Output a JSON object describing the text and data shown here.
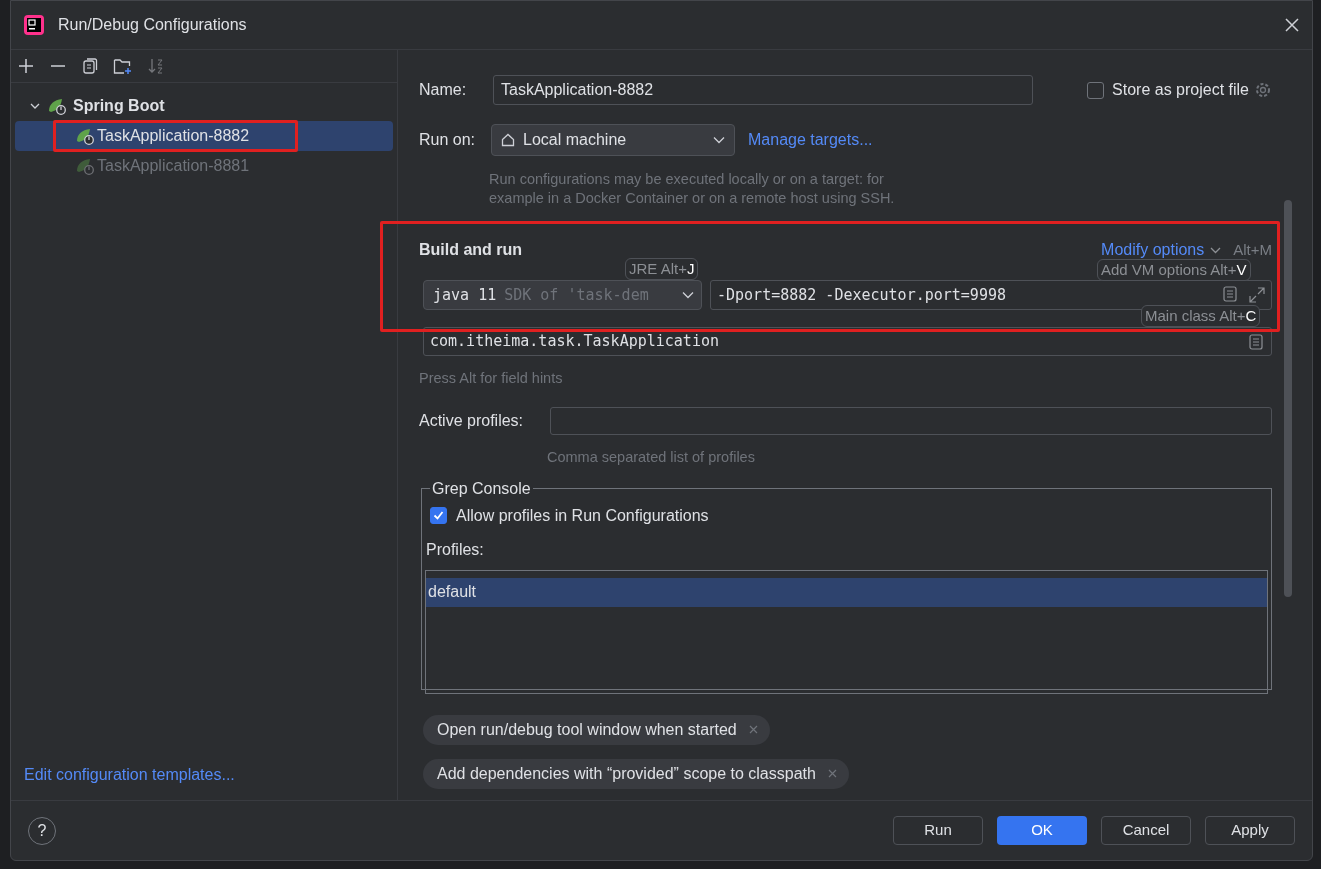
{
  "window": {
    "title": "Run/Debug Configurations"
  },
  "tree": [
    {
      "label": "Spring Boot",
      "expanded": true,
      "children": [
        {
          "label": "TaskApplication-8882",
          "selected": true,
          "dimmed": false
        },
        {
          "label": "TaskApplication-8881",
          "selected": false,
          "dimmed": true
        }
      ]
    }
  ],
  "templates_link": "Edit configuration templates...",
  "name": {
    "label": "Name:",
    "value": "TaskApplication-8882"
  },
  "store_as_project_file": {
    "label": "Store as project file",
    "checked": false
  },
  "run_on": {
    "label": "Run on:",
    "value": "Local machine",
    "link": "Manage targets...",
    "help": "Run configurations may be executed locally or on a target: for example in a Docker Container or on a remote host using SSH."
  },
  "build_and_run": {
    "title": "Build and run",
    "modify_link": "Modify options",
    "modify_shortcut": "Alt+M",
    "jre_value": "java 11",
    "jre_hint": "SDK of 'task-dem",
    "vm_options": "-Dport=8882 -Dexecutor.port=9998",
    "main_class": "com.itheima.task.TaskApplication",
    "field_hint": "Press Alt for field hints",
    "tooltips": [
      {
        "text": "JRE Alt+**J**"
      },
      {
        "text": "Add VM options Alt+**V**"
      },
      {
        "text": "Main class Alt+**C**"
      }
    ]
  },
  "active_profiles": {
    "label": "Active profiles:",
    "help": "Comma separated list of profiles"
  },
  "grep_console": {
    "title": "Grep Console",
    "allow": {
      "label": "Allow profiles in Run Configurations",
      "checked": true
    },
    "profiles_label": "Profiles:",
    "profiles": [
      {
        "label": "default",
        "selected": true
      }
    ]
  },
  "options": [
    {
      "label": "Open run/debug tool window when started"
    },
    {
      "label": "Add dependencies with “provided” scope to classpath"
    }
  ],
  "help_button": "?",
  "buttons": [
    {
      "label": "Run",
      "primary": false
    },
    {
      "label": "OK",
      "primary": true
    },
    {
      "label": "Cancel",
      "primary": false
    },
    {
      "label": "Apply",
      "primary": false
    }
  ]
}
